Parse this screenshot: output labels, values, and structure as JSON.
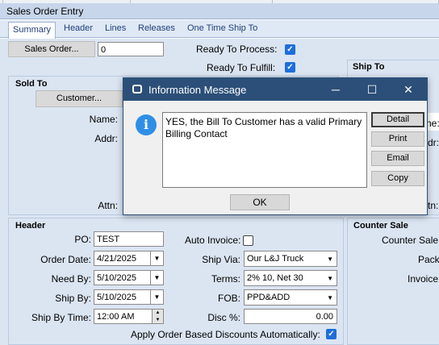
{
  "window": {
    "title": "Sales Order Entry"
  },
  "tabs": [
    {
      "label": "Summary"
    },
    {
      "label": "Header"
    },
    {
      "label": "Lines"
    },
    {
      "label": "Releases"
    },
    {
      "label": "One Time Ship To"
    }
  ],
  "top": {
    "sales_order_button": "Sales Order...",
    "sales_order_value": "0",
    "ready_to_process_label": "Ready To Process:",
    "ready_to_process_checked": true,
    "ready_to_fulfill_label": "Ready To Fulfill:",
    "ready_to_fulfill_checked": true
  },
  "sold_to": {
    "heading": "Sold To",
    "customer_button": "Customer...",
    "name_label": "Name:",
    "addr_label": "Addr:",
    "attn_label": "Attn:"
  },
  "ship_to": {
    "heading": "Ship To",
    "name_label_partial": "ne:",
    "addr_label_partial": "dr:",
    "attn_label_partial": "tn:"
  },
  "dialog": {
    "title": "Information Message",
    "message": "YES, the Bill To Customer has a valid Primary Billing Contact",
    "buttons": [
      "Detail",
      "Print",
      "Email",
      "Copy"
    ],
    "ok_label": "OK",
    "window_controls": {
      "minimize": "─",
      "maximize": "☐",
      "close": "✕"
    }
  },
  "header_section": {
    "heading": "Header",
    "po_label": "PO:",
    "po_value": "TEST",
    "order_date_label": "Order Date:",
    "order_date_value": "4/21/2025",
    "need_by_label": "Need By:",
    "need_by_value": "5/10/2025",
    "ship_by_label": "Ship By:",
    "ship_by_value": "5/10/2025",
    "ship_by_time_label": "Ship By Time:",
    "ship_by_time_value": "12:00 AM",
    "auto_invoice_label": "Auto Invoice:",
    "auto_invoice_checked": false,
    "ship_via_label": "Ship Via:",
    "ship_via_value": "Our L&J Truck",
    "terms_label": "Terms:",
    "terms_value": "2% 10, Net 30",
    "fob_label": "FOB:",
    "fob_value": "PPD&ADD",
    "disc_label": "Disc %:",
    "disc_value": "0.00",
    "apply_discounts_label": "Apply Order Based Discounts Automatically:",
    "apply_discounts_checked": true
  },
  "counter_sale": {
    "heading": "Counter Sale",
    "counter_sale_label": "Counter Sale",
    "pack_label": "Pack",
    "invoice_label": "Invoice"
  },
  "colors": {
    "dialog_title_bg": "#2b4f78",
    "panel_bg": "#dbe5f2",
    "accent_check": "#1e6fd9",
    "info_icon": "#2f8fe6"
  }
}
